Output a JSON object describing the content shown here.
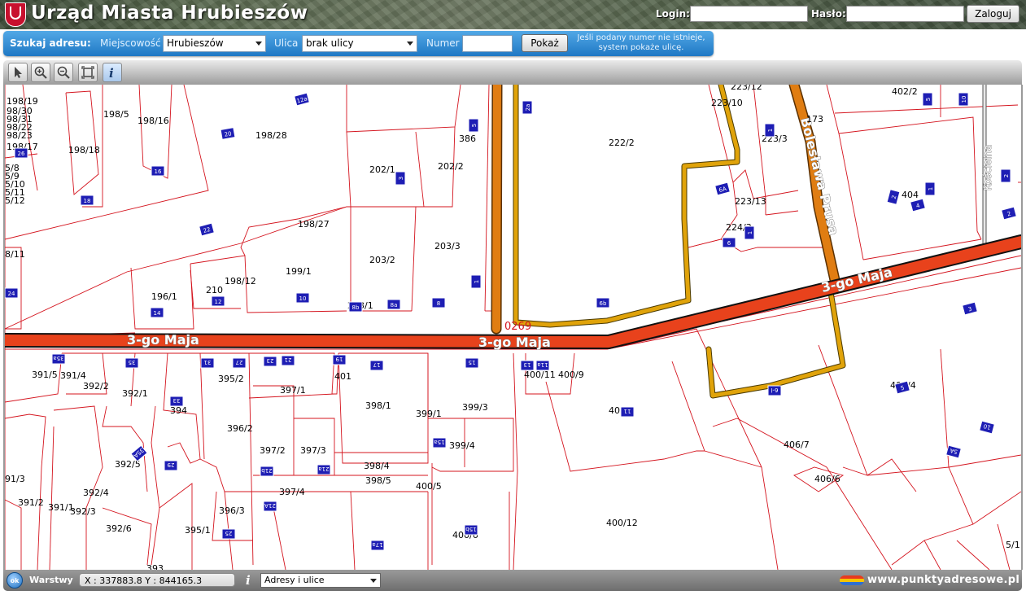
{
  "header": {
    "title": "Urząd Miasta Hrubieszów",
    "login_label": "Login:",
    "password_label": "Hasło:",
    "login_value": "",
    "password_value": "",
    "login_button": "Zaloguj"
  },
  "search": {
    "title": "Szukaj adresu:",
    "city_label": "Miejscowość",
    "city_value": "Hrubieszów",
    "street_label": "Ulica",
    "street_value": "brak ulicy",
    "number_label": "Numer",
    "number_value": "",
    "show_button": "Pokaż",
    "hint": "Jeśli podany numer nie istnieje, system pokaże ulicę."
  },
  "toolbar": {
    "tools": [
      "pointer-icon",
      "zoom-in-icon",
      "zoom-out-icon",
      "full-extent-icon",
      "info-icon"
    ]
  },
  "map": {
    "streets": [
      "3-go Maja",
      "3-go Maja",
      "3-go Maja",
      "Bolesława Prusa",
      "Kościelna"
    ],
    "road_label": "0269",
    "parcels": [
      "198/19",
      "98/30",
      "98/31",
      "98/22",
      "98/23",
      "198/17",
      "5/8",
      "5/9",
      "5/10",
      "5/11",
      "5/12",
      "198/5",
      "198/16",
      "198/18",
      "198/28",
      "198/27",
      "8/11",
      "196/1",
      "210",
      "198/12",
      "199/1",
      "202/1",
      "202/2",
      "386",
      "203/2",
      "203/3",
      "203/1",
      "222/2",
      "223/12",
      "223/10",
      "223/3",
      "223/13",
      "224/3",
      "173",
      "402/2",
      "404",
      "391/5",
      "391/4",
      "392/2",
      "392/1",
      "394",
      "395/2",
      "397/1",
      "401",
      "398/1",
      "399/1",
      "399/3",
      "399/4",
      "400/11",
      "400/9",
      "400/7",
      "400/4",
      "396/2",
      "397/2",
      "397/3",
      "392/5",
      "392/4",
      "398/4",
      "398/5",
      "400/5",
      "91/3",
      "391/2",
      "391/1",
      "392/3",
      "397/4",
      "396/3",
      "392/6",
      "395/1",
      "400/6",
      "400/12",
      "406/7",
      "406/6",
      "393",
      "5/1"
    ],
    "house_numbers": [
      "12a",
      "5",
      "20",
      "26",
      "16",
      "18",
      "22",
      "1",
      "3",
      "2a",
      "24",
      "14",
      "12",
      "10",
      "8b",
      "8a",
      "8",
      "1",
      "6b",
      "3",
      "6A",
      "6",
      "1",
      "5",
      "10",
      "2",
      "1",
      "4",
      "2",
      "2",
      "35a",
      "35",
      "31",
      "27",
      "23",
      "21",
      "19",
      "17",
      "15",
      "13",
      "11a",
      "33",
      "15a",
      "35A",
      "29",
      "21b",
      "21a",
      "21A",
      "17a",
      "15b",
      "25",
      "11",
      "3",
      "5",
      "10",
      "5A",
      "6-l"
    ]
  },
  "status": {
    "ok_label": "ok",
    "layers_label": "Warstwy",
    "coords": "X : 337883.8  Y : 844165.3",
    "layer_select": "Adresy i ulice",
    "brand": "www.punktyadresowe.pl"
  },
  "colors": {
    "parcel_line": "#d4141e",
    "main_road": "#e8421c",
    "side_road": "#e0a30a",
    "street_road": "#e07d12",
    "house_marker": "#1e1eb4"
  }
}
